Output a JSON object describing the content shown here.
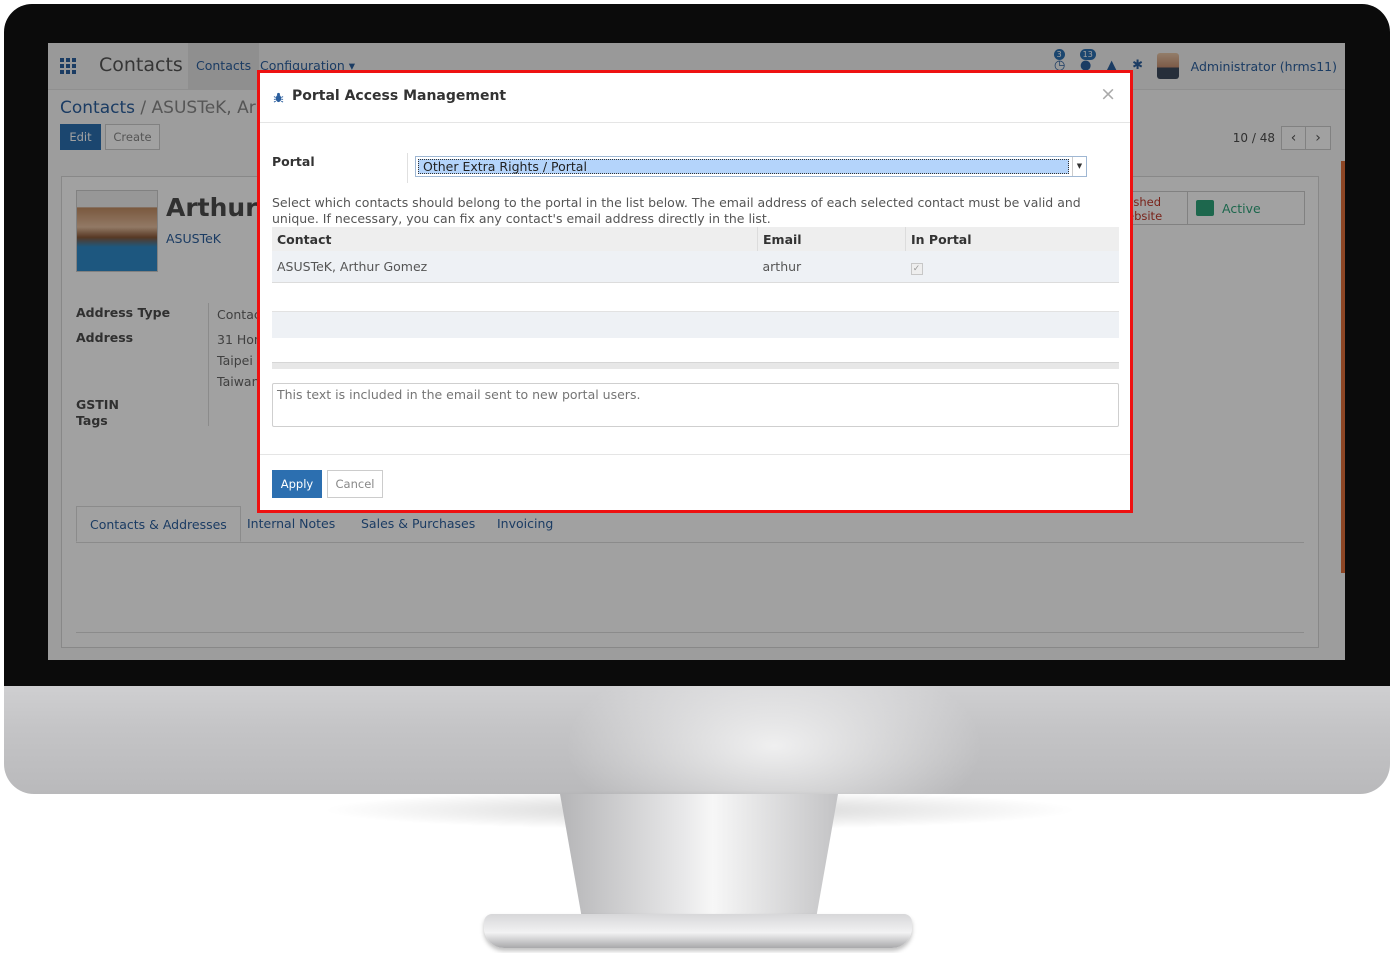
{
  "navbar": {
    "app_title": "Contacts",
    "menu_contacts": "Contacts",
    "menu_configuration": "Configuration",
    "activity_badge": "3",
    "message_badge": "13",
    "user": "Administrator (hrms11)"
  },
  "breadcrumb": {
    "root": "Contacts",
    "separator": "/",
    "current": "ASUSTeK, Ar"
  },
  "buttons": {
    "edit": "Edit",
    "create": "Create"
  },
  "pager": {
    "value": "10 / 48",
    "prev": "‹",
    "next": "›"
  },
  "partner": {
    "name": "Arthur",
    "company": "ASUSTeK",
    "published_label_1": "lished",
    "published_label_2": "ebsite",
    "active_label": "Active",
    "fields": {
      "address_type_label": "Address Type",
      "address_type_value": "Contac",
      "address_label": "Address",
      "address_line1": "31 Hon",
      "address_line2": "Taipei",
      "address_line3": "Taiwan",
      "gstin_label": "GSTIN",
      "tags_label": "Tags"
    },
    "tabs": [
      "Contacts & Addresses",
      "Internal Notes",
      "Sales & Purchases",
      "Invoicing"
    ]
  },
  "modal": {
    "title": "Portal Access Management",
    "close": "×",
    "portal_label": "Portal",
    "portal_value": "Other Extra Rights / Portal",
    "help_text": "Select which contacts should belong to the portal in the list below. The email address of each selected contact must be valid and unique. If necessary, you can fix any contact's email address directly in the list.",
    "columns": [
      "Contact",
      "Email",
      "In Portal"
    ],
    "rows": [
      {
        "contact": "ASUSTeK, Arthur Gomez",
        "email": "arthur",
        "in_portal": "✓"
      }
    ],
    "welcome_placeholder": "This text is included in the email sent to new portal users.",
    "apply": "Apply",
    "cancel": "Cancel"
  },
  "colors": {
    "accent": "#2c6fb0",
    "link": "#2c5f9e",
    "highlight_border": "#ee1111",
    "active_green": "#2ea37a"
  }
}
